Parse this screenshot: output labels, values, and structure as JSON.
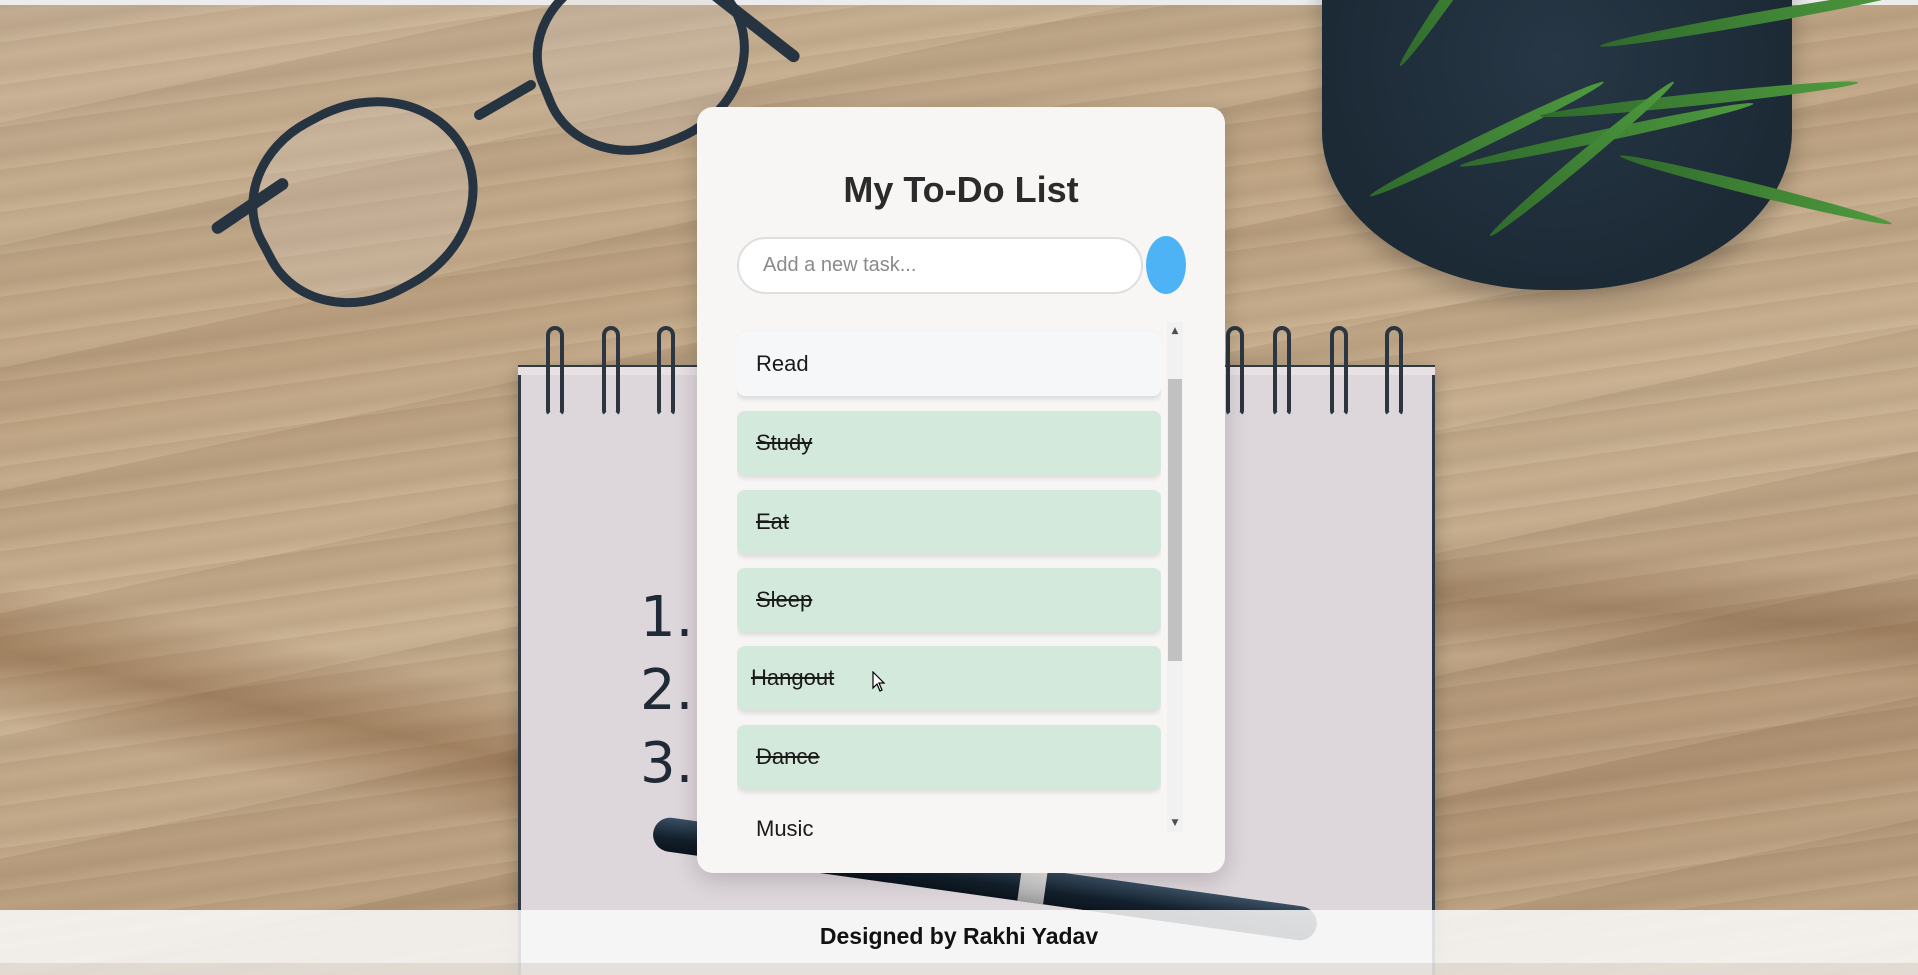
{
  "app": {
    "title": "My To-Do List"
  },
  "input": {
    "placeholder": "Add a new task...",
    "value": ""
  },
  "tasks": [
    {
      "label": "Read",
      "done": false
    },
    {
      "label": "Study",
      "done": true
    },
    {
      "label": "Eat",
      "done": true
    },
    {
      "label": "Sleep",
      "done": true
    },
    {
      "label": "Hangout",
      "done": true
    },
    {
      "label": "Dance",
      "done": true
    },
    {
      "label": "Music",
      "done": false
    }
  ],
  "footer": {
    "credit": "Designed by Rakhi Yadav"
  },
  "colors": {
    "accent": "#4db3f5",
    "done_bg": "#d3e9db",
    "pending_bg": "#f6f7f8"
  },
  "background": {
    "numbers": [
      "1.",
      "2.",
      "3."
    ]
  }
}
